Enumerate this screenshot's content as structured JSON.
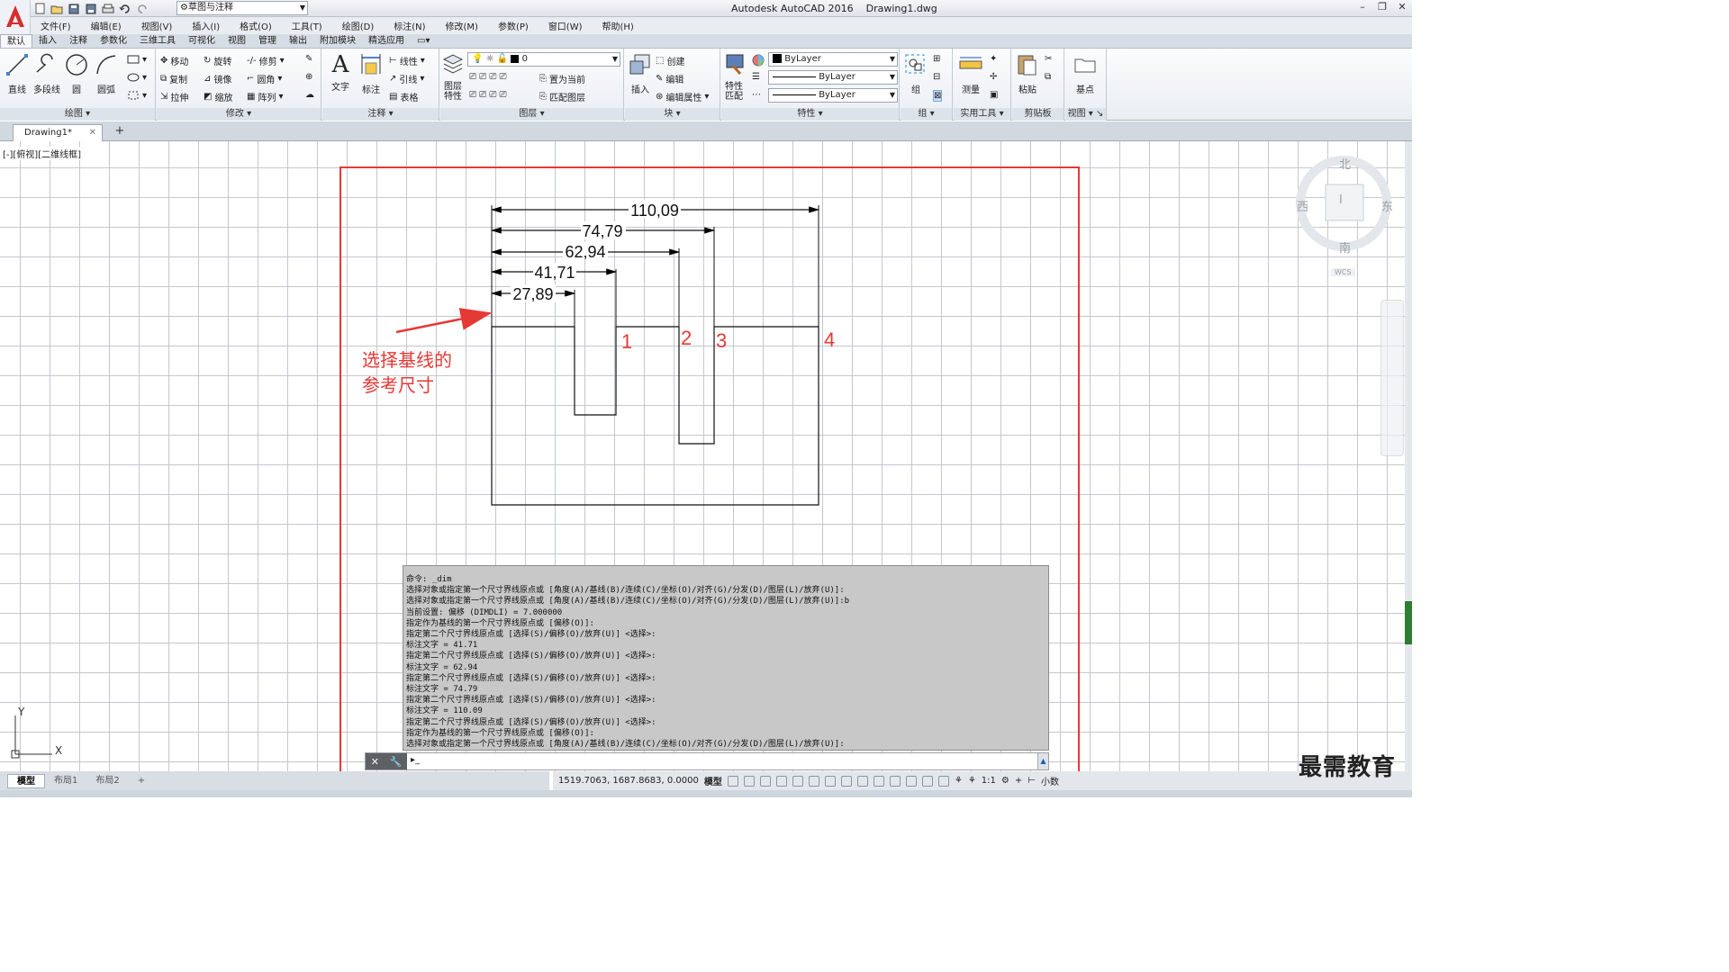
{
  "app": {
    "title": "Autodesk AutoCAD 2016",
    "file": "Drawing1.dwg",
    "workspace": "草图与注释"
  },
  "menubar": [
    "文件(F)",
    "编辑(E)",
    "视图(V)",
    "插入(I)",
    "格式(O)",
    "工具(T)",
    "绘图(D)",
    "标注(N)",
    "修改(M)",
    "参数(P)",
    "窗口(W)",
    "帮助(H)"
  ],
  "ribbon_tabs": [
    "默认",
    "插入",
    "注释",
    "参数化",
    "三维工具",
    "可视化",
    "视图",
    "管理",
    "输出",
    "附加模块",
    "精选应用"
  ],
  "ribbon": {
    "draw": {
      "title": "绘图",
      "line": "直线",
      "polyline": "多段线",
      "circle": "圆",
      "arc": "圆弧"
    },
    "modify": {
      "title": "修改",
      "move": "移动",
      "rotate": "旋转",
      "trim": "修剪",
      "copy": "复制",
      "mirror": "镜像",
      "fillet": "圆角",
      "stretch": "拉伸",
      "scale": "缩放",
      "array": "阵列"
    },
    "annotation": {
      "title": "注释",
      "text": "文字",
      "dimension": "标注",
      "linear": "线性",
      "leader": "引线",
      "table": "表格"
    },
    "layers": {
      "title": "图层",
      "props": "图层特性",
      "layer_value": "0",
      "set_current": "置为当前",
      "match": "匹配图层"
    },
    "block": {
      "title": "块",
      "insert": "插入",
      "create": "创建",
      "edit": "编辑",
      "edit_attr": "编辑属性"
    },
    "properties": {
      "title": "特性",
      "match": "特性匹配",
      "color": "ByLayer",
      "linetype": "ByLayer",
      "lineweight": "ByLayer"
    },
    "groups": {
      "title": "组",
      "group": "组"
    },
    "utilities": {
      "title": "实用工具",
      "measure": "测量"
    },
    "clipboard": {
      "title": "剪贴板",
      "paste": "粘贴"
    },
    "view": {
      "title": "视图",
      "base": "基点"
    }
  },
  "doc_tab": "Drawing1*",
  "viewport_label": "[-][俯视][二维线框]",
  "viewcube": {
    "n": "北",
    "s": "南",
    "e": "东",
    "w": "西",
    "top": "上",
    "wcs": "WCS"
  },
  "drawing": {
    "dims": [
      "110,09",
      "74,79",
      "62,94",
      "41,71",
      "27,89"
    ],
    "points": [
      "1",
      "2",
      "3",
      "4"
    ],
    "note_line1": "选择基线的",
    "note_line2": "参考尺寸"
  },
  "ucs": {
    "x": "X",
    "y": "Y"
  },
  "command_history": [
    "命令: _dim",
    "选择对象或指定第一个尺寸界线原点或 [角度(A)/基线(B)/连续(C)/坐标(O)/对齐(G)/分发(D)/图层(L)/放弃(U)]:",
    "选择对象或指定第一个尺寸界线原点或 [角度(A)/基线(B)/连续(C)/坐标(O)/对齐(G)/分发(D)/图层(L)/放弃(U)]:b",
    "当前设置: 偏移 (DIMDLI) = 7.000000",
    "指定作为基线的第一个尺寸界线原点或 [偏移(O)]:",
    "指定第二个尺寸界线原点或 [选择(S)/偏移(O)/放弃(U)] <选择>:",
    "标注文字 = 41.71",
    "指定第二个尺寸界线原点或 [选择(S)/偏移(O)/放弃(U)] <选择>:",
    "标注文字 = 62.94",
    "指定第二个尺寸界线原点或 [选择(S)/偏移(O)/放弃(U)] <选择>:",
    "标注文字 = 74.79",
    "指定第二个尺寸界线原点或 [选择(S)/偏移(O)/放弃(U)] <选择>:",
    "标注文字 = 110.09",
    "指定第二个尺寸界线原点或 [选择(S)/偏移(O)/放弃(U)] <选择>:",
    "指定作为基线的第一个尺寸界线原点或 [偏移(O)]:",
    "选择对象或指定第一个尺寸界线原点或 [角度(A)/基线(B)/连续(C)/坐标(O)/对齐(G)/分发(D)/图层(L)/放弃(U)]:"
  ],
  "layout_tabs": [
    "模型",
    "布局1",
    "布局2"
  ],
  "status": {
    "coords": "1519.7063, 1687.8683, 0.0000",
    "model": "模型",
    "scale": "1:1",
    "units": "小数"
  },
  "watermark": "最需教育",
  "colors": {
    "accent": "#e53935",
    "ribbon_bg": "#eaeef3"
  }
}
